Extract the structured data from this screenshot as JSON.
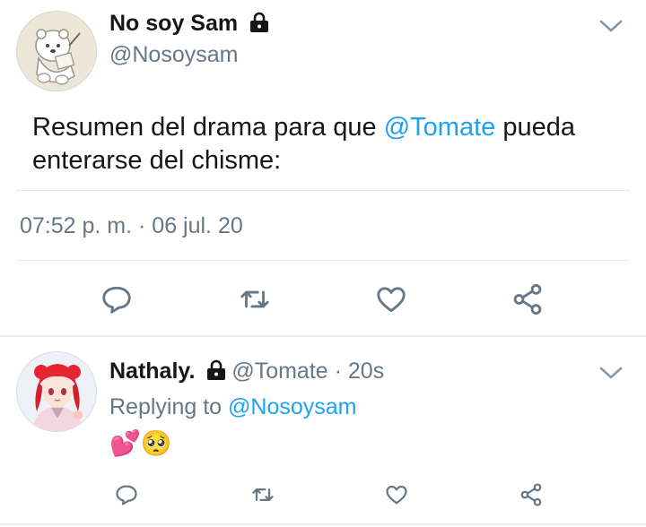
{
  "tweet": {
    "author_name": "No soy Sam",
    "author_handle": "@Nosoysam",
    "text_before": "Resumen del drama para que ",
    "mention": "@Tomate",
    "text_after": " pueda enterarse del chisme:",
    "timestamp": "07:52 p. m. · 06 jul. 20",
    "avatar_icon": "polar-bear-drawing-avatar",
    "locked_icon": "lock-icon"
  },
  "reply": {
    "author_name": "Nathaly.",
    "author_handle": "@Tomate",
    "time_sep": " · ",
    "time": "20s",
    "replying_prefix": "Replying to ",
    "replying_mention": "@Nosoysam",
    "content": "💕🥺",
    "avatar_icon": "red-hair-anime-girl-avatar"
  },
  "colors": {
    "text": "#14171a",
    "secondary": "#657786",
    "link": "#1da1f2",
    "icon": "#657786",
    "divider": "#e1e8ed"
  },
  "icons": {
    "actions": [
      "reply-icon",
      "retweet-icon",
      "like-icon",
      "share-icon"
    ],
    "menu": "chevron-down-icon"
  }
}
